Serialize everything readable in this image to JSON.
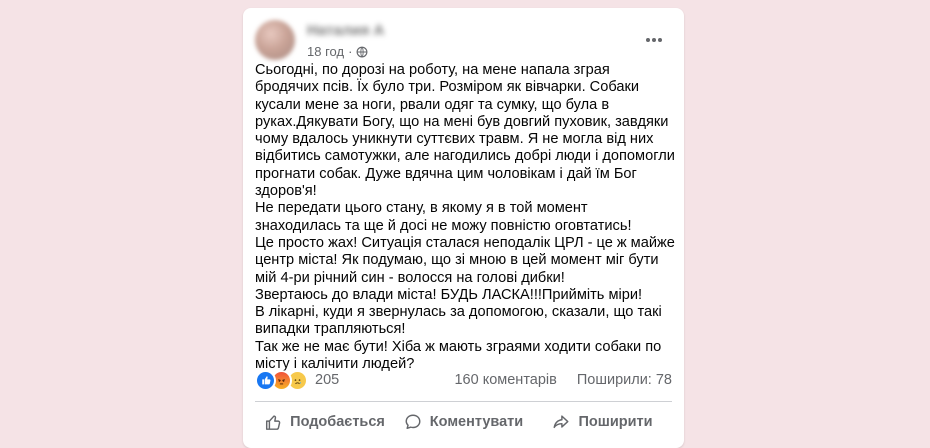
{
  "post": {
    "author_name": "Наталия А",
    "timestamp": "18 год",
    "separator": "·",
    "audience_icon": "globe-icon",
    "menu_icon": "more-horizontal-icon",
    "paragraphs": [
      "Сьогодні, по дорозі на роботу, на мене напала зграя бродячих псів. Їх було три. Розміром як вівчарки. Собаки кусали мене за ноги, рвали одяг та сумку, що була в руках.Дякувати Богу, що на мені був довгий пуховик, завдяки чому вдалось уникнути суттєвих травм. Я не могла від них відбитись самотужки, але нагодились добрі люди і допомогли прогнати собак. Дуже вдячна цим чоловікам і дай їм Бог здоров'я!",
      "Не передати цього стану, в якому я в той момент знаходилась та ще й досі не можу повністю оговтатись!",
      "Це просто жах! Ситуація сталася неподалік ЦРЛ - це ж майже центр міста! Як подумаю, що зі мною в цей момент міг бути мій 4-ри річний син - волосся на голові дибки!",
      "Звертаюсь до влади міста! БУДЬ ЛАСКА!!!Прийміть міри!",
      "В лікарні, куди я звернулась за допомогою, сказали, що такі випадки трапляються!",
      "Так же не має бути! Хіба ж мають зграями ходити собаки по місту і калічити людей?"
    ]
  },
  "stats": {
    "reaction_icons": [
      "like-reaction-icon",
      "angry-reaction-icon",
      "sad-reaction-icon"
    ],
    "reactions_count": "205",
    "comments": "160 коментарів",
    "shares": "Поширили: 78"
  },
  "actions": {
    "like_label": "Подобається",
    "comment_label": "Коментувати",
    "share_label": "Поширити"
  },
  "colors": {
    "background": "#f5e3e6",
    "card": "#ffffff",
    "secondary_text": "#65676b",
    "like_blue": "#1877f2"
  }
}
